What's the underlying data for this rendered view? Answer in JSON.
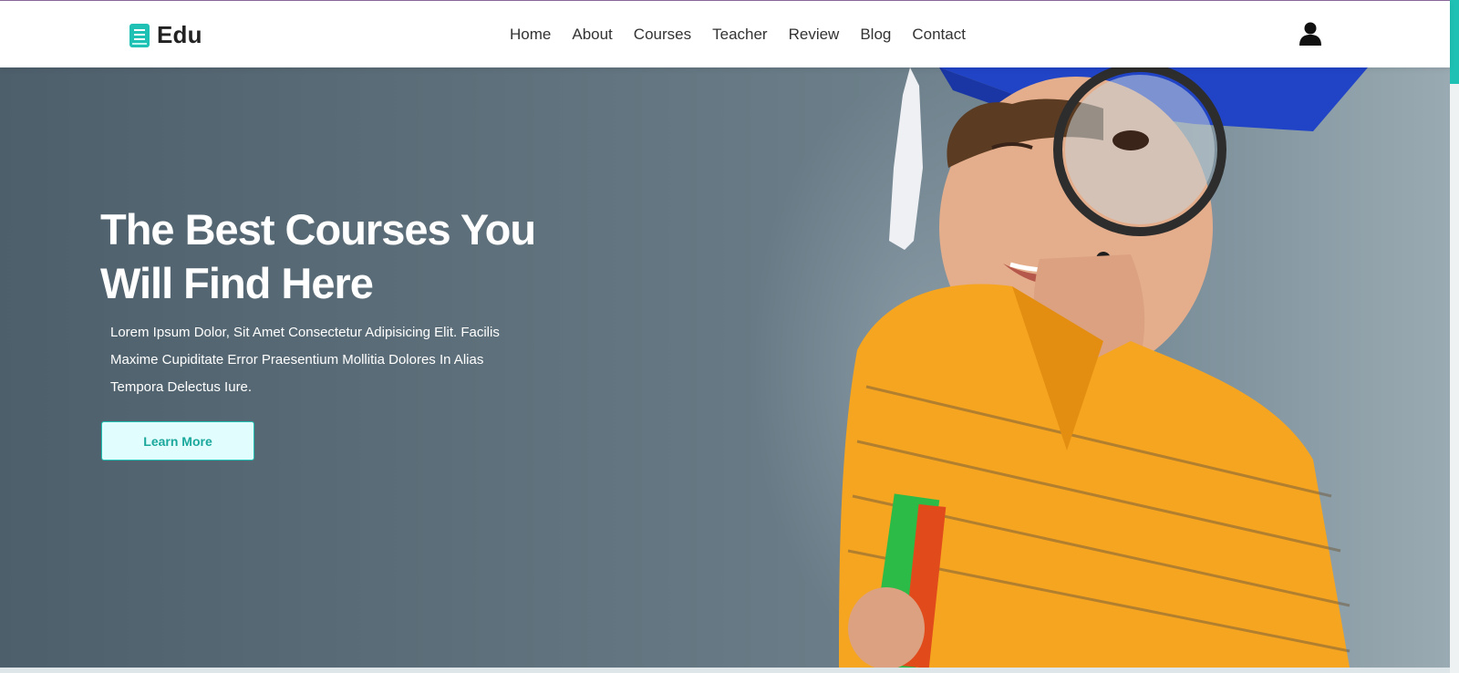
{
  "brand": {
    "name": "Edu"
  },
  "nav": {
    "items": [
      {
        "label": "Home"
      },
      {
        "label": "About"
      },
      {
        "label": "Courses"
      },
      {
        "label": "Teacher"
      },
      {
        "label": "Review"
      },
      {
        "label": "Blog"
      },
      {
        "label": "Contact"
      }
    ]
  },
  "hero": {
    "title_line1": "The Best Courses You",
    "title_line2": "Will Find Here",
    "text_line1": "Lorem Ipsum Dolor, Sit Amet Consectetur Adipisicing Elit. Facilis",
    "text_line2": "Maxime Cupiditate Error Praesentium Mollitia Dolores In Alias",
    "text_line3": "Tempora Delectus Iure.",
    "button_label": "Learn More"
  },
  "icons": {
    "logo": "book-icon",
    "user": "user-icon",
    "hero_image": "student-with-magnifying-glass-image"
  },
  "colors": {
    "accent": "#1fc1b4",
    "button_bg": "#e2fdfd",
    "hero_bg": "#5c6e79",
    "nav_text": "#333333"
  }
}
